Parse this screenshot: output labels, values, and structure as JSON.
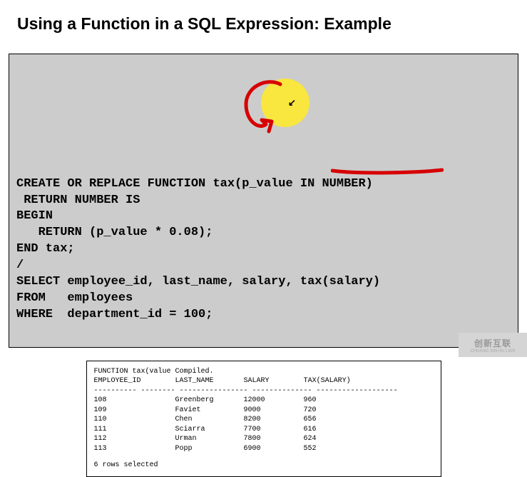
{
  "title": "Using a Function in a SQL Expression: Example",
  "code": {
    "line1": "CREATE OR REPLACE FUNCTION tax(p_value IN NUMBER)",
    "line2": " RETURN NUMBER IS",
    "line3": "BEGIN",
    "line4": "   RETURN (p_value * 0.08);",
    "line5": "END tax;",
    "line6": "/",
    "line7": "SELECT employee_id, last_name, salary, tax(salary)",
    "line8": "FROM   employees",
    "line9": "WHERE  department_id = 100;"
  },
  "output": {
    "compile_line": "FUNCTION tax(value Compiled.",
    "headers": {
      "col1": "EMPLOYEE_ID",
      "col2": "LAST_NAME",
      "col3": "SALARY",
      "col4": "TAX(SALARY)"
    },
    "rows": [
      {
        "id": "108",
        "name": "Greenberg",
        "salary": "12000",
        "tax": "960"
      },
      {
        "id": "109",
        "name": "Faviet",
        "salary": "9000",
        "tax": "720"
      },
      {
        "id": "110",
        "name": "Chen",
        "salary": "8200",
        "tax": "656"
      },
      {
        "id": "111",
        "name": "Sciarra",
        "salary": "7700",
        "tax": "616"
      },
      {
        "id": "112",
        "name": "Urman",
        "salary": "7800",
        "tax": "624"
      },
      {
        "id": "113",
        "name": "Popp",
        "salary": "6900",
        "tax": "552"
      }
    ],
    "footer": "6 rows selected"
  },
  "watermark": {
    "logo": "创新互联",
    "sub": "CHUANG XIN HU LIAN"
  }
}
